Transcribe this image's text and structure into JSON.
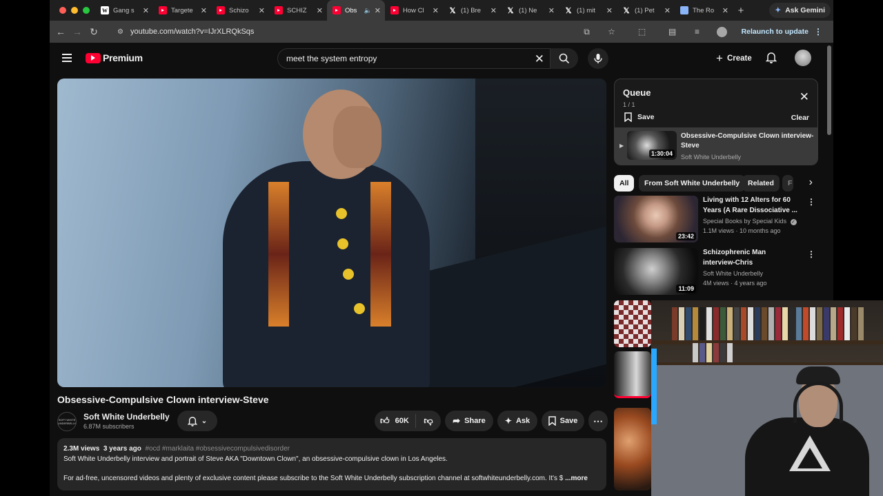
{
  "browser": {
    "tabs": [
      {
        "label": "Gang s",
        "icon": "wikipedia-icon"
      },
      {
        "label": "Targete",
        "icon": "youtube-icon"
      },
      {
        "label": "Schizo",
        "icon": "youtube-icon"
      },
      {
        "label": "SCHIZ",
        "icon": "youtube-icon"
      },
      {
        "label": "Obs",
        "icon": "youtube-icon",
        "active": true
      },
      {
        "label": "How Cl",
        "icon": "youtube-icon"
      },
      {
        "label": "(1) Bre",
        "icon": "x-icon"
      },
      {
        "label": "(1) Ne",
        "icon": "x-icon"
      },
      {
        "label": "(1) mit",
        "icon": "x-icon"
      },
      {
        "label": "(1) Pet",
        "icon": "x-icon"
      },
      {
        "label": "The Ro",
        "icon": "doc-icon"
      }
    ],
    "new_tab": "+",
    "gemini_label": "Ask Gemini",
    "url": "youtube.com/watch?v=IJrXLRQkSqs",
    "relaunch_label": "Relaunch to update"
  },
  "masthead": {
    "logo_text": "Premium",
    "search_value": "meet the system entropy",
    "create_label": "Create"
  },
  "video": {
    "title": "Obsessive-Compulsive Clown interview-Steve",
    "channel": "Soft White Underbelly",
    "channel_avatar_text": "SOFT WHITE UNDERBELLY",
    "subscribers": "6.87M subscribers",
    "likes": "60K",
    "share_label": "Share",
    "ask_label": "Ask",
    "save_label": "Save",
    "views": "2.3M views",
    "age": "3 years ago",
    "tags": "#ocd #marklaita #obsessivecompulsivedisorder",
    "desc_line1": "Soft White Underbelly interview and portrait of Steve AKA \"Downtown Clown\", an obsessive-compulsive clown in Los Angeles.",
    "desc_line2": "For ad-free, uncensored videos and plenty of exclusive content please subscribe to the Soft White Underbelly subscription channel at softwhiteunderbelly.com. It's $",
    "more_label": "...more"
  },
  "queue": {
    "title": "Queue",
    "count": "1 / 1",
    "save_label": "Save",
    "clear_label": "Clear",
    "item": {
      "title": "Obsessive-Compulsive Clown interview-Steve",
      "channel": "Soft White Underbelly",
      "duration": "1:30:04"
    }
  },
  "chips": [
    "All",
    "From Soft White Underbelly",
    "Related",
    "F"
  ],
  "recommendations": [
    {
      "title": "Living with 12 Alters for 60 Years (A Rare Dissociative ...",
      "channel": "Special Books by Special Kids",
      "verified": true,
      "meta": "1.1M views · 10 months ago",
      "duration": "23:42"
    },
    {
      "title": "Schizophrenic Man interview-Chris",
      "channel": "Soft White Underbelly",
      "meta": "4M views · 4 years ago",
      "duration": "11:09"
    }
  ],
  "colors": {
    "yt_red": "#ff0033",
    "background": "#0f0f0f",
    "chip_bg": "#272727",
    "link_blue": "#c2e7ff"
  }
}
